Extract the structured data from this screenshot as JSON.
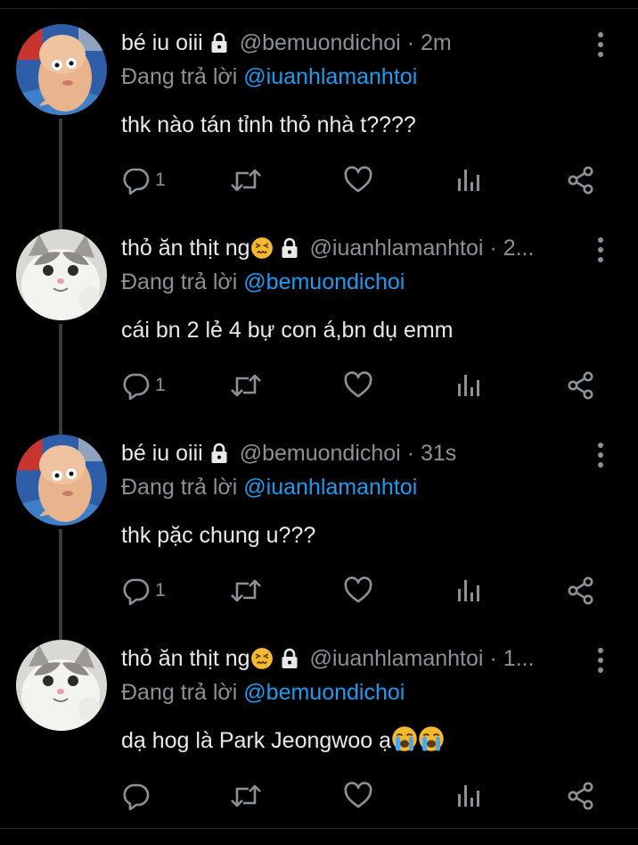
{
  "reply_prefix": "Đang trả lời",
  "tweets": [
    {
      "avatar": "baby-avatar",
      "name": "bé iu oiii",
      "handle": "@bemuondichoi",
      "time": "· 2m",
      "reply_to": "@iuanhlamanhtoi",
      "text": "thk nào tán tỉnh thỏ nhà t????",
      "reply_count": "1"
    },
    {
      "avatar": "cat-avatar",
      "name": "thỏ ăn thịt ng",
      "handle": "@iuanhlamanhtoi",
      "time": "· 2...",
      "reply_to": "@bemuondichoi",
      "text": "cái bn 2 lẻ 4 bự con á,bn dụ emm",
      "reply_count": "1"
    },
    {
      "avatar": "baby-avatar",
      "name": "bé iu oiii",
      "handle": "@bemuondichoi",
      "time": "· 31s",
      "reply_to": "@iuanhlamanhtoi",
      "text": "thk pặc chung u???",
      "reply_count": "1"
    },
    {
      "avatar": "cat-avatar",
      "name": "thỏ ăn thịt ng",
      "handle": "@iuanhlamanhtoi",
      "time": "· 1...",
      "reply_to": "@bemuondichoi",
      "text": "dạ hog là Park Jeongwoo ạ",
      "reply_count": ""
    }
  ],
  "colors": {
    "background": "#000000",
    "text": "#e7e9ea",
    "muted": "#8b9197",
    "accent": "#1d9bf0"
  },
  "icons": [
    "lock-icon",
    "confounded-face-emoji",
    "loudly-crying-face-emoji",
    "more-icon",
    "reply-icon",
    "retweet-icon",
    "like-icon",
    "views-icon",
    "share-icon"
  ]
}
